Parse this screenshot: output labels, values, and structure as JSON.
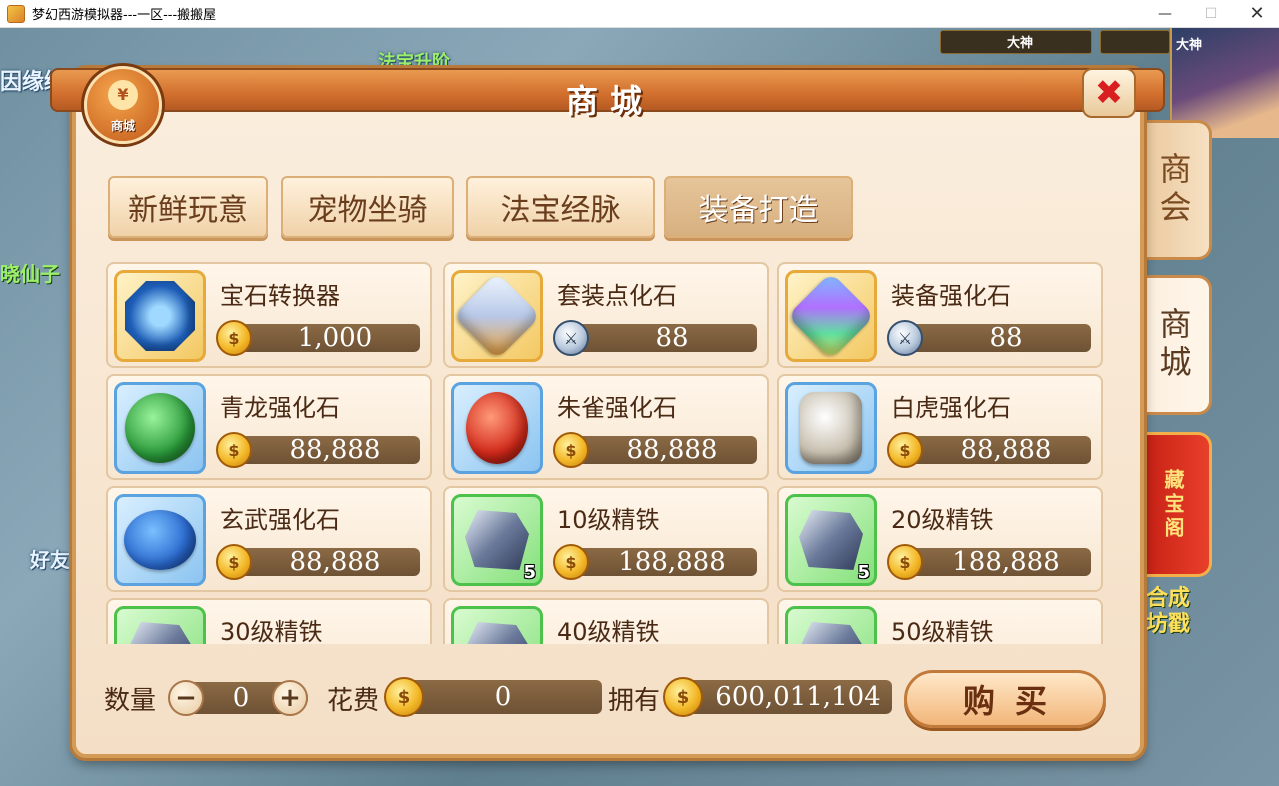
{
  "window": {
    "title": "梦幻西游模拟器---一区---搬搬屋",
    "min_symbol": "—",
    "max_symbol": "☐",
    "close_symbol": "✕"
  },
  "background": {
    "left_texts": [
      "因缘绘",
      "晓仙子",
      "好友"
    ],
    "top_text": "法宝升阶",
    "right_texts": [
      "合成",
      "坊戳"
    ],
    "rank_labels": [
      "大神",
      "大神"
    ]
  },
  "shop": {
    "title": "商城",
    "badge_symbol": "¥",
    "badge_label": "商城",
    "close_icon": "✖",
    "side_tabs": [
      {
        "label": "商会",
        "active": false
      },
      {
        "label": "商城",
        "active": true
      },
      {
        "label": "藏宝阁",
        "active": false
      }
    ],
    "categories": [
      {
        "label": "新鲜玩意",
        "active": false
      },
      {
        "label": "宠物坐骑",
        "active": false
      },
      {
        "label": "法宝经脉",
        "active": false
      },
      {
        "label": "装备打造",
        "active": true
      }
    ],
    "items": [
      {
        "name": "宝石转换器",
        "price": "1,000",
        "currency": "gold-coin",
        "frame": "gold",
        "icon": "bagua-gem-icon"
      },
      {
        "name": "套装点化石",
        "price": "88",
        "currency": "silver-sword",
        "frame": "gold",
        "icon": "crystal-stone-icon"
      },
      {
        "name": "装备强化石",
        "price": "88",
        "currency": "silver-sword",
        "frame": "gold",
        "icon": "rainbow-stone-icon"
      },
      {
        "name": "青龙强化石",
        "price": "88,888",
        "currency": "gold-coin",
        "frame": "blue",
        "icon": "green-dragon-stone-icon"
      },
      {
        "name": "朱雀强化石",
        "price": "88,888",
        "currency": "gold-coin",
        "frame": "blue",
        "icon": "red-phoenix-stone-icon"
      },
      {
        "name": "白虎强化石",
        "price": "88,888",
        "currency": "gold-coin",
        "frame": "blue",
        "icon": "white-tiger-stone-icon"
      },
      {
        "name": "玄武强化石",
        "price": "88,888",
        "currency": "gold-coin",
        "frame": "blue",
        "icon": "black-tortoise-stone-icon"
      },
      {
        "name": "10级精铁",
        "price": "188,888",
        "currency": "gold-coin",
        "frame": "green",
        "icon": "iron-ingot-icon",
        "badge": "5"
      },
      {
        "name": "20级精铁",
        "price": "188,888",
        "currency": "gold-coin",
        "frame": "green",
        "icon": "iron-ingot-icon",
        "badge": "5"
      },
      {
        "name": "30级精铁",
        "price": "",
        "currency": "gold-coin",
        "frame": "green",
        "icon": "iron-ingot-icon"
      },
      {
        "name": "40级精铁",
        "price": "",
        "currency": "gold-coin",
        "frame": "green",
        "icon": "iron-ingot-icon"
      },
      {
        "name": "50级精铁",
        "price": "",
        "currency": "gold-coin",
        "frame": "green",
        "icon": "iron-ingot-icon"
      }
    ],
    "bottom": {
      "quantity_label": "数量",
      "minus_symbol": "−",
      "plus_symbol": "+",
      "quantity_value": "0",
      "cost_label": "花费",
      "cost_value": "0",
      "owned_label": "拥有",
      "owned_value": "600,011,104",
      "buy_label": "购买"
    },
    "coin_glyph": "$",
    "silver_glyph": "⚔"
  }
}
